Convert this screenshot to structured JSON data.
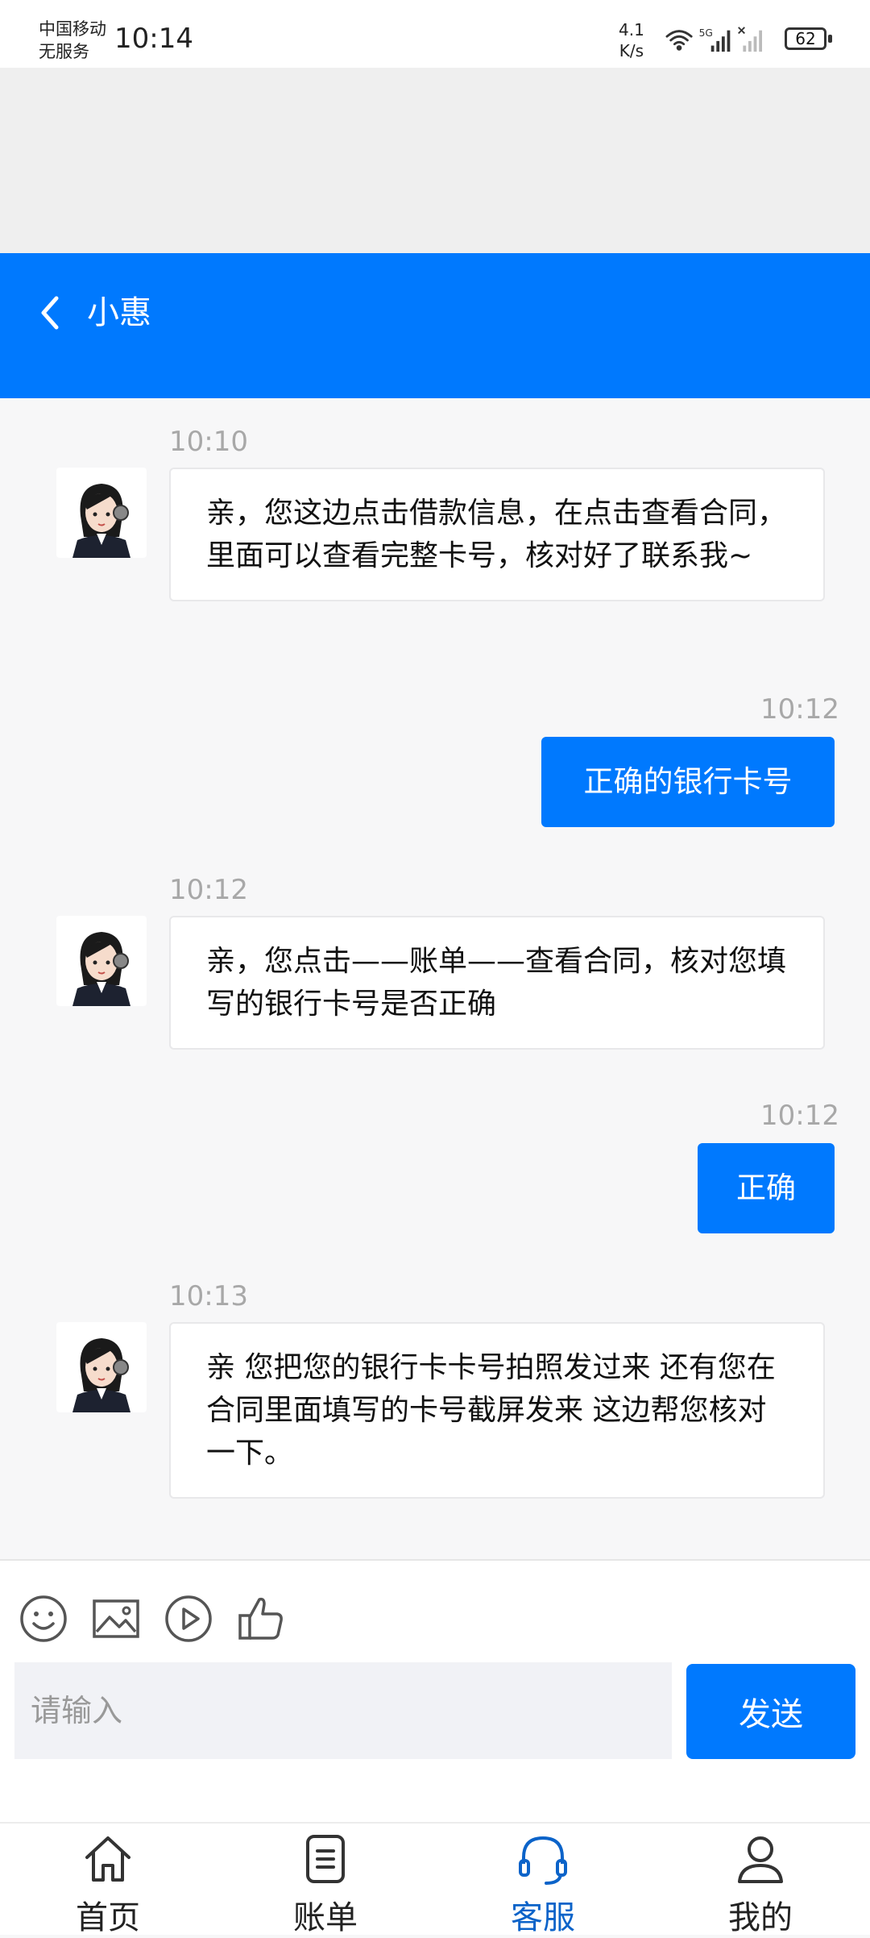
{
  "status_bar": {
    "carrier_line1": "中国移动",
    "carrier_line2": "无服务",
    "time": "10:14",
    "net_speed_value": "4.1",
    "net_speed_unit": "K/s",
    "network_type": "5G",
    "battery": "62"
  },
  "header": {
    "title": "小惠"
  },
  "messages": [
    {
      "time": "10:10",
      "text": "亲，您这边点击借款信息，在点击查看合同，里面可以查看完整卡号，核对好了联系我~"
    },
    {
      "time": "10:12",
      "text": "正确的银行卡号"
    },
    {
      "time": "10:12",
      "text": "亲，您点击——账单——查看合同，核对您填写的银行卡号是否正确"
    },
    {
      "time": "10:12",
      "text": "正确"
    },
    {
      "time": "10:13",
      "text": "亲 您把您的银行卡卡号拍照发过来 还有您在合同里面填写的卡号截屏发来 这边帮您核对一下。"
    }
  ],
  "input": {
    "placeholder": "请输入",
    "send_label": "发送"
  },
  "toolbar_icons": [
    "emoji-icon",
    "image-icon",
    "video-icon",
    "thumbs-up-icon"
  ],
  "nav": {
    "items": [
      {
        "label": "首页"
      },
      {
        "label": "账单"
      },
      {
        "label": "客服"
      },
      {
        "label": "我的"
      }
    ],
    "active": "客服"
  },
  "colors": {
    "accent": "#0079fe",
    "nav_active": "#0b63c9",
    "background": "#f7f7f8"
  }
}
